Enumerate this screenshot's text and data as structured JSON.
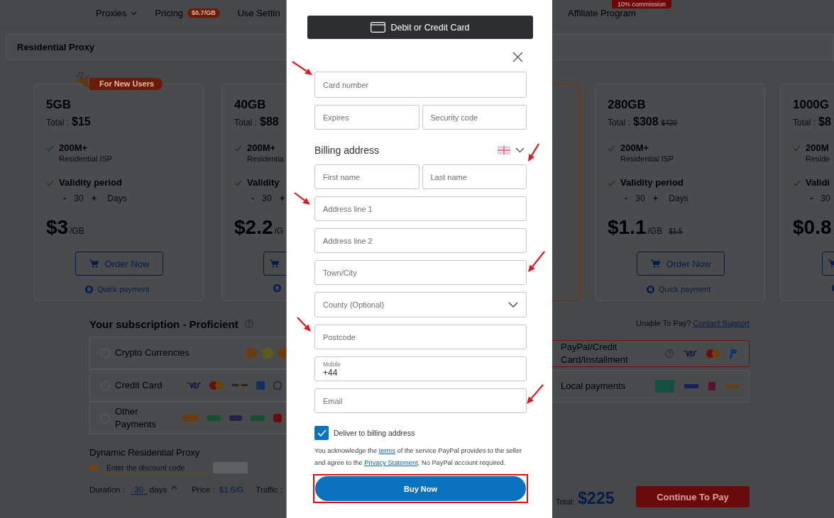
{
  "nav": [
    {
      "label": "Proxies",
      "dropdown": true
    },
    {
      "label": "Pricing",
      "badge": "$0.7/GB"
    },
    {
      "label": "Use Settin"
    },
    {
      "label": "Affiliate Program",
      "flag": "10% commission"
    }
  ],
  "product_tab": "Residential Proxy",
  "plans": [
    {
      "size": "5GB",
      "badge": "For New Users",
      "total_label": "Total :",
      "total": "$15",
      "features": [
        {
          "title": "200M+",
          "detail": "Residential ISP"
        },
        {
          "title": "Validity period"
        }
      ],
      "days": {
        "minus": "-",
        "value": "30",
        "plus": "+",
        "unit": "Days"
      },
      "price": "$3",
      "unit": "/GB",
      "order": "Order Now",
      "quick": "Quick payment",
      "selected": false
    },
    {
      "size": "40GB",
      "total_label": "Total :",
      "total": "$88",
      "features": [
        {
          "title": "200M+",
          "detail": "Residentia"
        },
        {
          "title": "Validity"
        }
      ],
      "days": {
        "minus": "-",
        "value": "30",
        "plus": "+"
      },
      "price": "$2.2",
      "unit": "/G",
      "selected": false
    },
    {
      "selected": true
    },
    {
      "size": "280GB",
      "total_label": "Total :",
      "total": "$308",
      "total_old": "$420",
      "features": [
        {
          "title": "200M+",
          "detail": "Residential ISP"
        },
        {
          "title": "Validity period"
        }
      ],
      "days": {
        "minus": "-",
        "value": "30",
        "plus": "+",
        "unit": "Days"
      },
      "price": "$1.1",
      "unit": "/GB",
      "price_old": "$1.5",
      "order": "Order Now",
      "quick": "Quick payment",
      "selected": false
    },
    {
      "size": "1000G",
      "total_label": "Total :",
      "total": "$8",
      "features": [
        {
          "title": "200M",
          "detail": "Reside"
        },
        {
          "title": "Validi"
        }
      ],
      "days": {
        "minus": "-",
        "value": "30"
      },
      "price": "$0.8",
      "selected": false
    }
  ],
  "subscription": {
    "title": "Your subscription - Proficient",
    "unable": "Unable To Pay?",
    "support": "Contact Support",
    "options": [
      {
        "kind": "crypto",
        "label": "Crypto Currencies",
        "selected": false
      },
      {
        "kind": "card",
        "label": "Credit Card",
        "selected": false
      },
      {
        "kind": "other",
        "label": "Other Payments",
        "selected": false
      },
      {
        "kind": "paypal",
        "label": "PayPal/Credit Card/Installment",
        "selected": true
      },
      {
        "kind": "local",
        "label": "Local payments",
        "selected": false
      }
    ],
    "product": "Dynamic Residential Proxy",
    "discount_placeholder": "Enter the discount code",
    "duration_label": "Duration :",
    "duration": "30",
    "duration_unit": "days",
    "price_label": "Price :",
    "price": "$1.5/G",
    "traffic_label": "Traffic :",
    "total_label": "Total:",
    "total": "$225",
    "continue": "Continue To Pay"
  },
  "payment_dialog": {
    "method_button": "Debit or Credit Card",
    "card_rows": [
      [
        {
          "kind": "text",
          "placeholder": "Card number"
        }
      ],
      [
        {
          "kind": "text",
          "placeholder": "Expires"
        },
        {
          "kind": "text",
          "placeholder": "Security code"
        }
      ]
    ],
    "billing_title": "Billing address",
    "address_rows": [
      [
        {
          "kind": "text",
          "placeholder": "First name"
        },
        {
          "kind": "text",
          "placeholder": "Last name"
        }
      ],
      [
        {
          "kind": "text",
          "placeholder": "Address line 1"
        }
      ],
      [
        {
          "kind": "text",
          "placeholder": "Address line 2"
        }
      ],
      [
        {
          "kind": "text",
          "placeholder": "Town/City"
        }
      ],
      [
        {
          "kind": "select",
          "placeholder": "County (Optional)"
        }
      ],
      [
        {
          "kind": "text",
          "placeholder": "Postcode"
        }
      ],
      [
        {
          "kind": "labeled",
          "label": "Mobile",
          "value": "+44"
        }
      ],
      [
        {
          "kind": "text",
          "placeholder": "Email"
        }
      ]
    ],
    "deliver": {
      "label": "Deliver to billing address",
      "checked": true
    },
    "notice": [
      {
        "text": "You acknowledge the "
      },
      {
        "link": "terms"
      },
      {
        "text": " of the service PayPal provides to the seller and agree to the "
      },
      {
        "link": "Privacy Statement"
      },
      {
        "text": ". No PayPal account required."
      }
    ],
    "buy_button": {
      "label": "Buy Now",
      "highlighted": true
    }
  }
}
